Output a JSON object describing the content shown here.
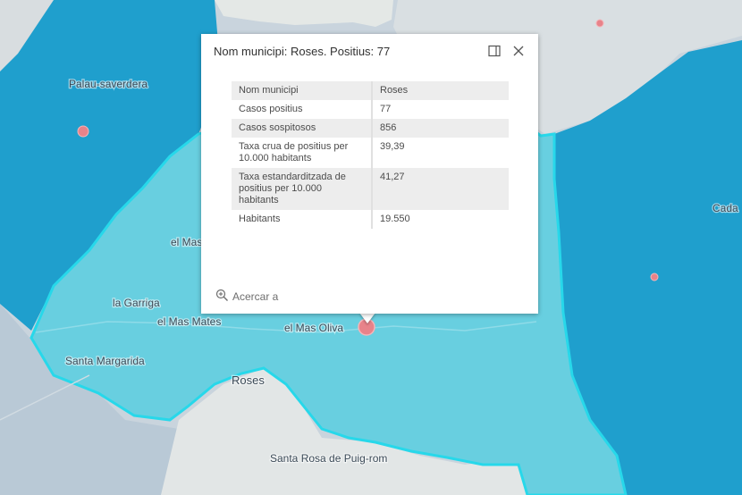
{
  "map": {
    "places": {
      "palau": "Palau-saverdera",
      "el_mas": "el Mas",
      "la_garriga": "la Garriga",
      "el_mas_mates": "el Mas Mates",
      "el_mas_oliva": "el Mas Oliva",
      "santa_margarida": "Santa Margarida",
      "roses": "Roses",
      "santa_rosa": "Santa Rosa de Puig-rom",
      "cadaques": "Cada"
    },
    "colors": {
      "water": "#c9d4dd",
      "land": "#e2e6e6",
      "dark_blue": "#1f9fcd",
      "light_cyan": "#68cfe0",
      "highlight": "#27d8ea",
      "marker": "#e8838a"
    }
  },
  "popup": {
    "title": "Nom municipi: Roses. Positius: 77",
    "dock_icon": "dock-icon",
    "close_icon": "close-icon",
    "rows": [
      {
        "key": "Nom municipi",
        "value": "Roses"
      },
      {
        "key": "Casos positius",
        "value": "77"
      },
      {
        "key": "Casos sospitosos",
        "value": "856"
      },
      {
        "key": "Taxa crua de positius per 10.000 habitants",
        "value": "39,39"
      },
      {
        "key": "Taxa estandarditzada de positius per 10.000 habitants",
        "value": "41,27"
      },
      {
        "key": "Habitants",
        "value": "19.550"
      }
    ],
    "zoom_label": "Acercar a"
  }
}
